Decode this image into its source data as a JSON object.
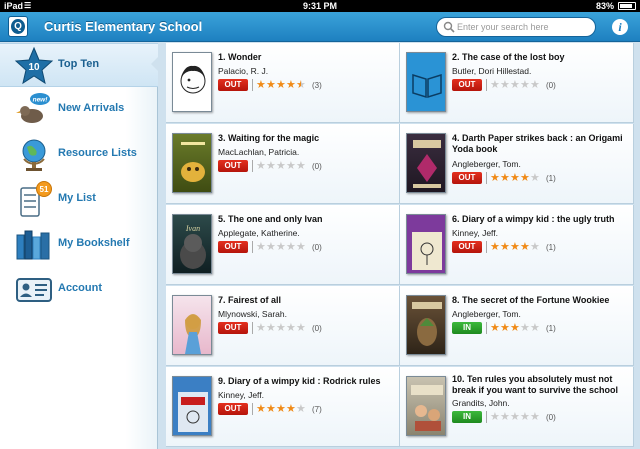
{
  "status_bar": {
    "device": "iPad",
    "time": "9:31 PM",
    "battery": "83%",
    "battery_level": 0.83
  },
  "header": {
    "title": "Curtis Elementary School",
    "search_placeholder": "Enter your search here",
    "info_label": "i"
  },
  "sidebar": {
    "items": [
      {
        "label": "Top Ten",
        "badge": "10",
        "icon": "star-icon",
        "active": true
      },
      {
        "label": "New Arrivals",
        "badge": "new!",
        "icon": "bird-icon",
        "active": false
      },
      {
        "label": "Resource Lists",
        "icon": "globe-icon",
        "active": false
      },
      {
        "label": "My List",
        "badge": "51",
        "icon": "notepad-icon",
        "active": false
      },
      {
        "label": "My Bookshelf",
        "icon": "bookshelf-icon",
        "active": false
      },
      {
        "label": "Account",
        "icon": "id-card-icon",
        "active": false
      }
    ]
  },
  "colors": {
    "accent": "#1e80c0",
    "out": "#d2231a",
    "in": "#2ea12e",
    "star": "#f08a17"
  },
  "books": [
    {
      "title": "1. Wonder",
      "author": "Palacio, R. J.",
      "status": "OUT",
      "rating": 4.5,
      "count": "(3)"
    },
    {
      "title": "2. The case of the lost boy",
      "author": "Butler, Dori Hillestad.",
      "status": "OUT",
      "rating": 0,
      "count": "(0)"
    },
    {
      "title": "3. Waiting for the magic",
      "author": "MacLachlan, Patricia.",
      "status": "OUT",
      "rating": 0,
      "count": "(0)"
    },
    {
      "title": "4. Darth Paper strikes back : an Origami Yoda book",
      "author": "Angleberger, Tom.",
      "status": "OUT",
      "rating": 4,
      "count": "(1)"
    },
    {
      "title": "5. The one and only Ivan",
      "author": "Applegate, Katherine.",
      "status": "OUT",
      "rating": 0,
      "count": "(0)"
    },
    {
      "title": "6. Diary of a wimpy kid : the ugly truth",
      "author": "Kinney, Jeff.",
      "status": "OUT",
      "rating": 4,
      "count": "(1)"
    },
    {
      "title": "7. Fairest of all",
      "author": "Mlynowski, Sarah.",
      "status": "OUT",
      "rating": 0,
      "count": "(0)"
    },
    {
      "title": "8. The secret of the Fortune Wookiee",
      "author": "Angleberger, Tom.",
      "status": "IN",
      "rating": 3,
      "count": "(1)"
    },
    {
      "title": "9. Diary of a wimpy kid : Rodrick rules",
      "author": "Kinney, Jeff.",
      "status": "OUT",
      "rating": 4,
      "count": "(7)"
    },
    {
      "title": "10. Ten rules you absolutely must not break if you want to survive the school",
      "author": "Grandits, John.",
      "status": "IN",
      "rating": 0,
      "count": "(0)"
    }
  ]
}
